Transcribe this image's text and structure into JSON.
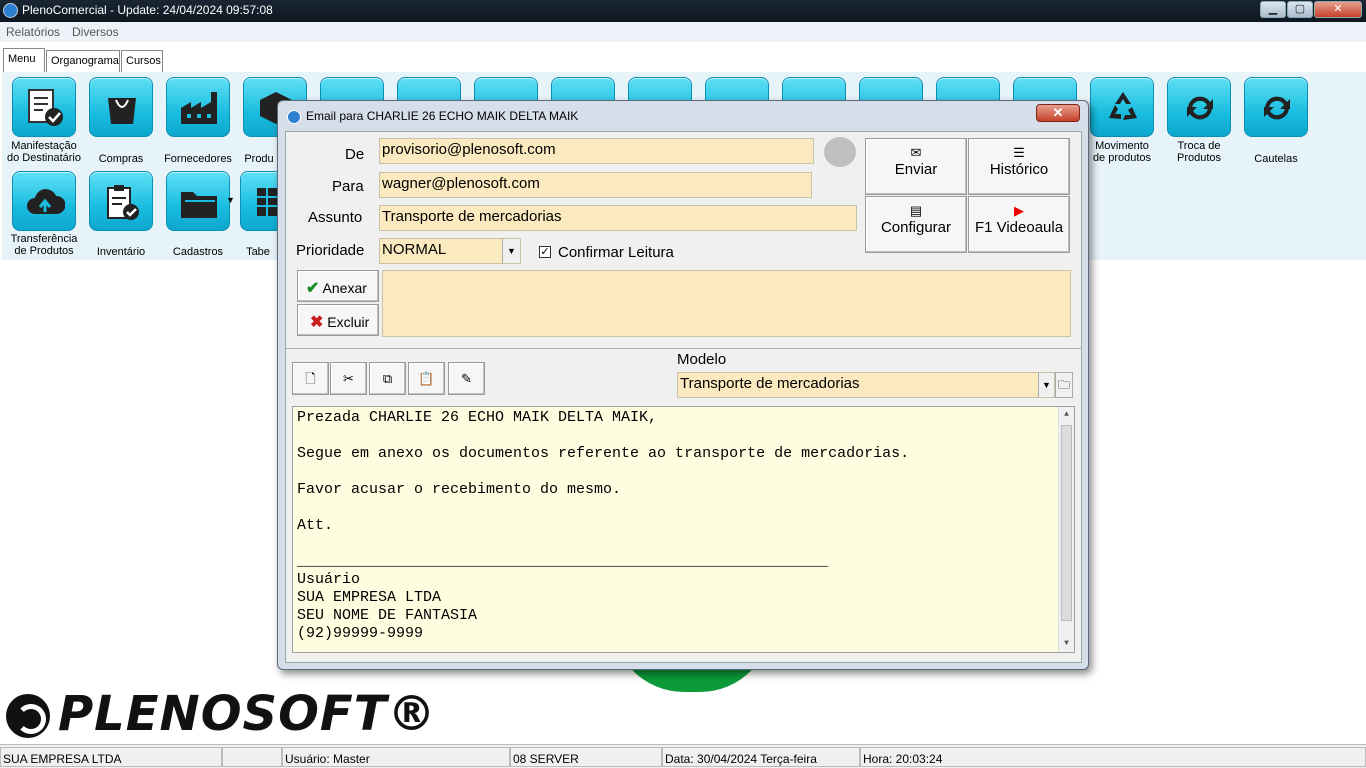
{
  "window": {
    "title": "PlenoComercial - Update: 24/04/2024 09:57:08"
  },
  "menubar": {
    "items": [
      "Relatórios",
      "Diversos"
    ]
  },
  "tabs": [
    "Menu",
    "Organograma",
    "Cursos"
  ],
  "launcher": {
    "tiles": [
      {
        "label": "Manifestação\ndo Destinatário",
        "icon": "document-check-icon"
      },
      {
        "label": "Compras",
        "icon": "shopping-bag-icon"
      },
      {
        "label": "Fornecedores",
        "icon": "factory-icon"
      },
      {
        "label": "Produ",
        "icon": "box-icon"
      },
      {
        "label": "Movimento\nde produtos",
        "icon": "recycle-arrows-icon"
      },
      {
        "label": "Troca de\nProdutos",
        "icon": "exchange-arrows-icon"
      },
      {
        "label": "Cautelas",
        "icon": "refresh-arrows-icon"
      },
      {
        "label": "Transferência\nde Produtos",
        "icon": "cloud-upload-icon"
      },
      {
        "label": "Inventário",
        "icon": "clipboard-check-icon"
      },
      {
        "label": "Cadastros",
        "icon": "folder-icon"
      },
      {
        "label": "Tabe",
        "icon": "table-icon"
      }
    ]
  },
  "logo": {
    "text": "PLENOSOFT®"
  },
  "statusbar": {
    "company": "SUA EMPRESA LTDA",
    "user": "Usuário: Master",
    "server": "08 SERVER",
    "date": "Data: 30/04/2024 Terça-feira",
    "time": "Hora: 20:03:24"
  },
  "dialog": {
    "title": "Email para CHARLIE 26 ECHO MAIK DELTA MAIK",
    "close_label": "✕",
    "labels": {
      "from": "De",
      "to": "Para",
      "subject": "Assunto",
      "priority": "Prioridade",
      "model": "Modelo"
    },
    "from": "provisorio@plenosoft.com",
    "to": "wagner@plenosoft.com",
    "subject": "Transporte de mercadorias",
    "priority": "NORMAL",
    "confirm_read_label": "Confirmar Leitura",
    "confirm_read_checked": true,
    "buttons": {
      "send": "Enviar",
      "history": "Histórico",
      "configure": "Configurar",
      "video": "F1 Videoaula",
      "attach": "Anexar",
      "remove": "Excluir"
    },
    "model": "Transporte de mercadorias",
    "body_lines": [
      "Prezada CHARLIE 26 ECHO MAIK DELTA MAIK,",
      "",
      "Segue em anexo os documentos referente ao transporte de mercadorias.",
      "",
      "Favor acusar o recebimento do mesmo.",
      "",
      "Att.",
      "",
      "___________________________________________________________",
      "Usuário",
      "SUA EMPRESA LTDA",
      "SEU NOME DE FANTASIA",
      "(92)99999-9999"
    ]
  }
}
